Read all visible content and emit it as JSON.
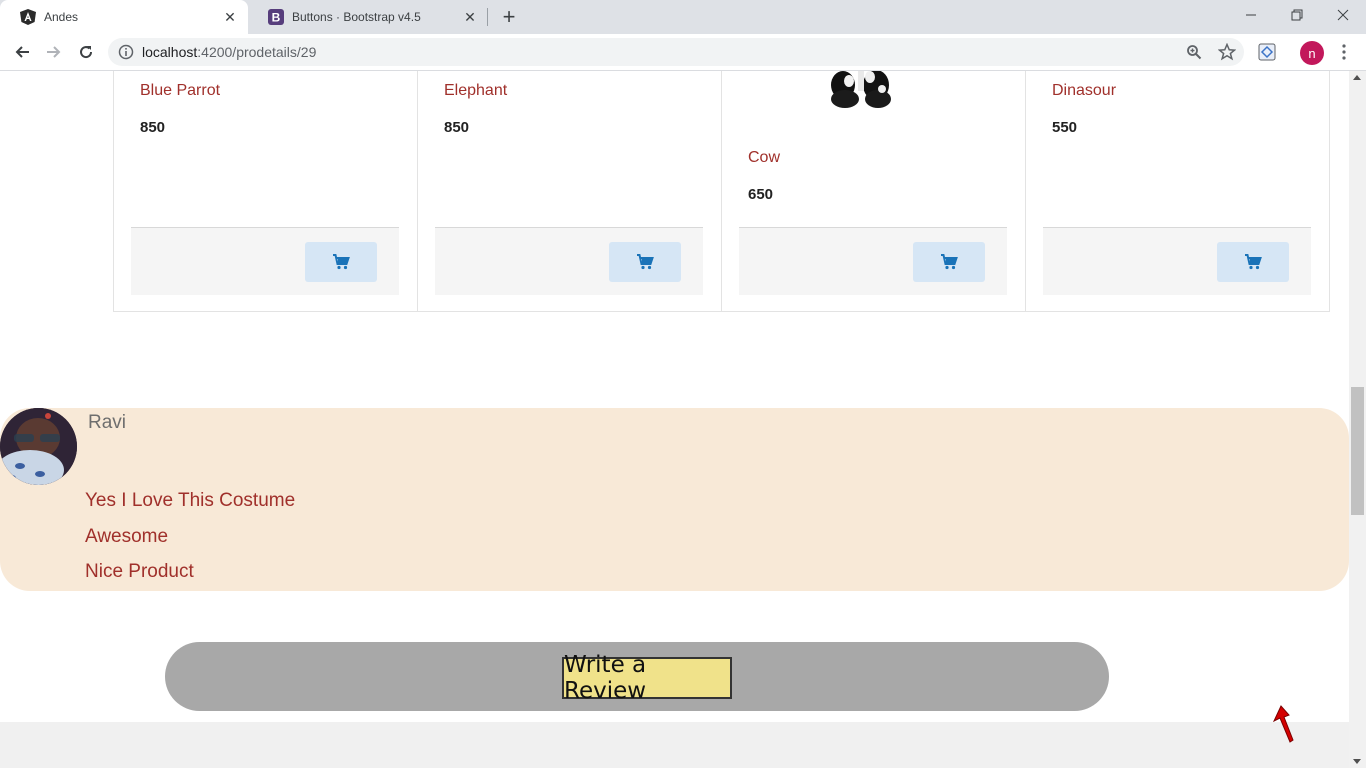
{
  "browser": {
    "tabs": [
      {
        "title": "Andes",
        "favicon": "angular-icon",
        "active": true
      },
      {
        "title": "Buttons · Bootstrap v4.5",
        "favicon": "bootstrap-icon",
        "active": false
      }
    ],
    "url_host": "localhost",
    "url_rest": ":4200/prodetails/29",
    "profile_initial": "n"
  },
  "products": [
    {
      "name": "Blue Parrot",
      "price": "850"
    },
    {
      "name": "Elephant",
      "price": "850"
    },
    {
      "name": "Cow",
      "price": "650"
    },
    {
      "name": "Dinasour",
      "price": "550"
    }
  ],
  "review": {
    "reviewer": "Ravi",
    "comments": [
      "Yes I Love This Costume",
      "Awesome",
      "Nice Product"
    ]
  },
  "write_review_label": "Write a Review",
  "colors": {
    "product_name": "#a0302b",
    "review_bg": "#f8e9d7",
    "write_bar": "#a8a8a8",
    "write_button": "#f0e28a",
    "cart_button": "#d6e6f5",
    "cart_icon": "#1a73b8"
  }
}
